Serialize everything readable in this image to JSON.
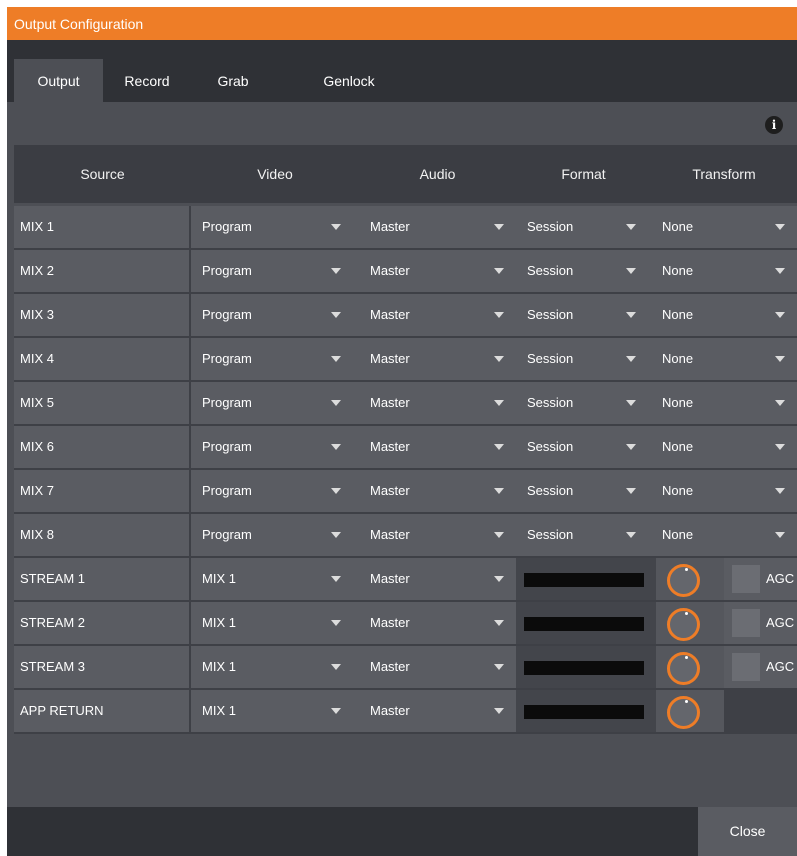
{
  "window": {
    "title": "Output Configuration"
  },
  "tabs": [
    {
      "label": "Output",
      "active": true
    },
    {
      "label": "Record",
      "active": false
    },
    {
      "label": "Grab",
      "active": false
    },
    {
      "label": "Genlock",
      "active": false
    }
  ],
  "info_icon": {
    "glyph": "i",
    "name": "info-icon"
  },
  "columns": [
    "Source",
    "Video",
    "Audio",
    "Format",
    "Transform"
  ],
  "rows": [
    {
      "source": "MIX 1",
      "video": "Program",
      "audio": "Master",
      "format": "Session",
      "transform": "None"
    },
    {
      "source": "MIX 2",
      "video": "Program",
      "audio": "Master",
      "format": "Session",
      "transform": "None"
    },
    {
      "source": "MIX 3",
      "video": "Program",
      "audio": "Master",
      "format": "Session",
      "transform": "None"
    },
    {
      "source": "MIX 4",
      "video": "Program",
      "audio": "Master",
      "format": "Session",
      "transform": "None"
    },
    {
      "source": "MIX 5",
      "video": "Program",
      "audio": "Master",
      "format": "Session",
      "transform": "None"
    },
    {
      "source": "MIX 6",
      "video": "Program",
      "audio": "Master",
      "format": "Session",
      "transform": "None"
    },
    {
      "source": "MIX 7",
      "video": "Program",
      "audio": "Master",
      "format": "Session",
      "transform": "None"
    },
    {
      "source": "MIX 8",
      "video": "Program",
      "audio": "Master",
      "format": "Session",
      "transform": "None"
    }
  ],
  "audio_rows": [
    {
      "source": "STREAM 1",
      "video": "MIX 1",
      "audio": "Master",
      "agc": "AGC"
    },
    {
      "source": "STREAM 2",
      "video": "MIX 1",
      "audio": "Master",
      "agc": "AGC"
    },
    {
      "source": "STREAM 3",
      "video": "MIX 1",
      "audio": "Master",
      "agc": "AGC"
    },
    {
      "source": "APP RETURN",
      "video": "MIX 1",
      "audio": "Master",
      "agc": ""
    }
  ],
  "footer": {
    "close_label": "Close"
  },
  "colors": {
    "accent": "#ee7d27",
    "panel": "#4d4f55",
    "row": "#5a5c62",
    "dark": "#2f3136"
  }
}
